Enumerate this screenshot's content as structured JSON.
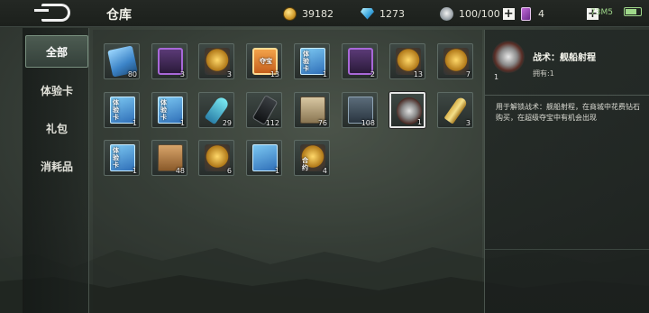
{
  "header": {
    "title": "仓库",
    "resources": [
      {
        "icon": "gold-coin-icon",
        "value": "39182"
      },
      {
        "icon": "diamond-icon",
        "value": "1273"
      },
      {
        "icon": "fuel-icon",
        "value": "100/100"
      },
      {
        "icon": "card-ticket-icon",
        "value": "4"
      }
    ],
    "status_text": "73M5"
  },
  "sidebar": {
    "tabs": [
      {
        "label": "全部",
        "active": true
      },
      {
        "label": "体验卡",
        "active": false
      },
      {
        "label": "礼包",
        "active": false
      },
      {
        "label": "消耗品",
        "active": false
      }
    ]
  },
  "items": [
    {
      "icon": "blue-card-icon",
      "count": "80"
    },
    {
      "icon": "purple-crate-icon",
      "count": "3"
    },
    {
      "icon": "medal-icon",
      "count": "3"
    },
    {
      "icon": "ticket-icon",
      "label": "夺宝",
      "count": "13"
    },
    {
      "icon": "trial-card-icon",
      "label": "体验卡",
      "count": "1"
    },
    {
      "icon": "purple-crate-icon",
      "count": "2"
    },
    {
      "icon": "medal-icon",
      "count": "13"
    },
    {
      "icon": "medal-icon",
      "count": "7"
    },
    {
      "icon": "trial-card-icon",
      "label": "体验卡",
      "count": "1"
    },
    {
      "icon": "trial-card-icon",
      "label": "体验卡",
      "count": "1"
    },
    {
      "icon": "spray-icon",
      "count": "29"
    },
    {
      "icon": "radio-icon",
      "count": "112"
    },
    {
      "icon": "book-icon",
      "count": "76"
    },
    {
      "icon": "blueprint-icon",
      "count": "108"
    },
    {
      "icon": "ship-tactic-icon",
      "count": "1",
      "selected": true
    },
    {
      "icon": "ammo-icon",
      "count": "3"
    },
    {
      "icon": "trial-card-icon",
      "label": "体验卡",
      "count": "1"
    },
    {
      "icon": "book-icon",
      "count": "48"
    },
    {
      "icon": "medal-icon",
      "count": "6"
    },
    {
      "icon": "trial-card-icon",
      "count": "1"
    },
    {
      "icon": "medal-icon",
      "label": "合约",
      "count": "4"
    }
  ],
  "detail": {
    "icon": "ship-tactic-icon",
    "count": "1",
    "name": "战术：舰船射程",
    "owned": "拥有:1",
    "description": "用于解锁战术：舰船射程，在商城中花费钻石购买，在超级夺宝中有机会出现"
  },
  "colors": {
    "selected_border": "#e5e5e5",
    "active_tab": "#4d5c52",
    "status_green": "#9fd88a"
  }
}
